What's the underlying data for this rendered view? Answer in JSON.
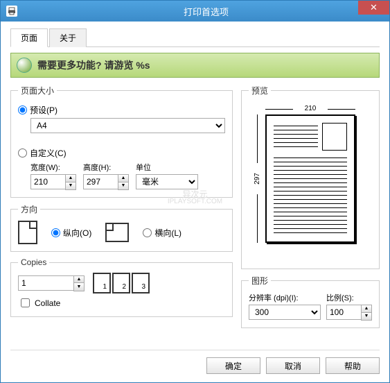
{
  "window_title": "打印首选项",
  "close_glyph": "✕",
  "tabs": {
    "page": "页面",
    "about": "关于"
  },
  "banner": {
    "text": "需要更多功能? 请游览 %s"
  },
  "page_size": {
    "legend": "页面大小",
    "preset_label": "预设(P)",
    "preset_value": "A4",
    "custom_label": "自定义(C)",
    "width_label": "宽度(W):",
    "width_value": "210",
    "height_label": "高度(H):",
    "height_value": "297",
    "unit_label": "单位",
    "unit_value": "毫米"
  },
  "orientation": {
    "legend": "方向",
    "portrait_label": "纵向(O)",
    "landscape_label": "横向(L)"
  },
  "copies": {
    "legend": "Copies",
    "value": "1",
    "collate_label": "Collate",
    "icon_labels": [
      "1",
      "2",
      "3"
    ]
  },
  "preview": {
    "legend": "预览",
    "width_dim": "210",
    "height_dim": "297"
  },
  "graphics": {
    "legend": "图形",
    "dpi_label": "分辨率 (dpi)(I):",
    "dpi_value": "300",
    "scale_label": "比例(S):",
    "scale_value": "100"
  },
  "buttons": {
    "ok": "确定",
    "cancel": "取消",
    "help": "帮助"
  },
  "watermark": {
    "line1": "异次元",
    "line2": "IPLAYSOFT.COM"
  }
}
